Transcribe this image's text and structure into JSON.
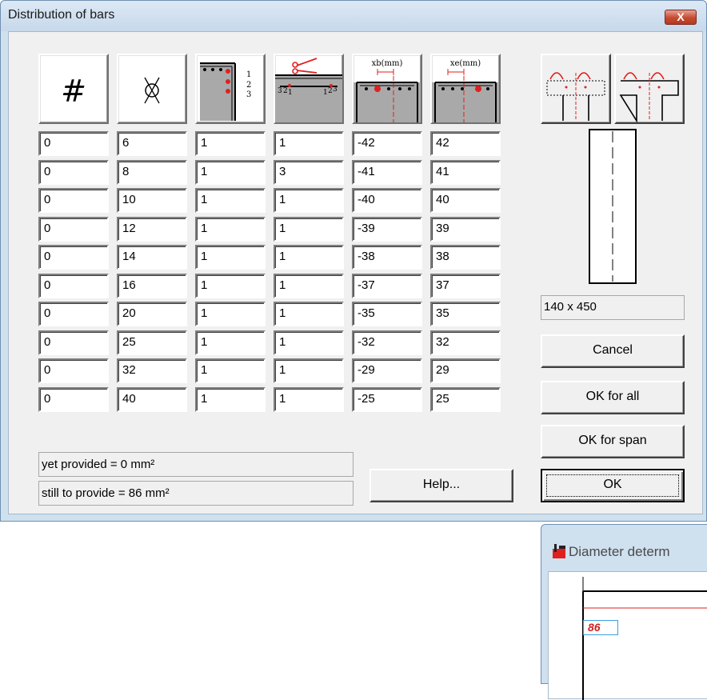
{
  "dialog": {
    "title": "Distribution of bars",
    "close_glyph": "X"
  },
  "headers": [
    "#",
    "diameter-icon",
    "layer-icon",
    "cut-icon",
    "xb(mm)",
    "xe(mm)"
  ],
  "rows": [
    [
      "0",
      "6",
      "1",
      "1",
      "-42",
      "42"
    ],
    [
      "0",
      "8",
      "1",
      "3",
      "-41",
      "41"
    ],
    [
      "0",
      "10",
      "1",
      "1",
      "-40",
      "40"
    ],
    [
      "0",
      "12",
      "1",
      "1",
      "-39",
      "39"
    ],
    [
      "0",
      "14",
      "1",
      "1",
      "-38",
      "38"
    ],
    [
      "0",
      "16",
      "1",
      "1",
      "-37",
      "37"
    ],
    [
      "0",
      "20",
      "1",
      "1",
      "-35",
      "35"
    ],
    [
      "0",
      "25",
      "1",
      "1",
      "-32",
      "32"
    ],
    [
      "0",
      "32",
      "1",
      "1",
      "-29",
      "29"
    ],
    [
      "0",
      "40",
      "1",
      "1",
      "-25",
      "25"
    ]
  ],
  "layer_labels": [
    "1",
    "2",
    "3"
  ],
  "cut_labels": [
    "3",
    "2",
    "1",
    "1",
    "2",
    "3"
  ],
  "status": {
    "yet_provided": "yet provided = 0 mm²",
    "still_to_provide": "still to provide = 86 mm²"
  },
  "section_size": "140 x 450",
  "buttons": {
    "help": "Help...",
    "cancel": "Cancel",
    "ok_all": "OK for all",
    "ok_span": "OK for span",
    "ok": "OK"
  },
  "second_window": {
    "title": "Diameter determ",
    "value": "86"
  },
  "colors": {
    "accent_red": "#e02020",
    "title_blue": "#cfe0ef"
  }
}
